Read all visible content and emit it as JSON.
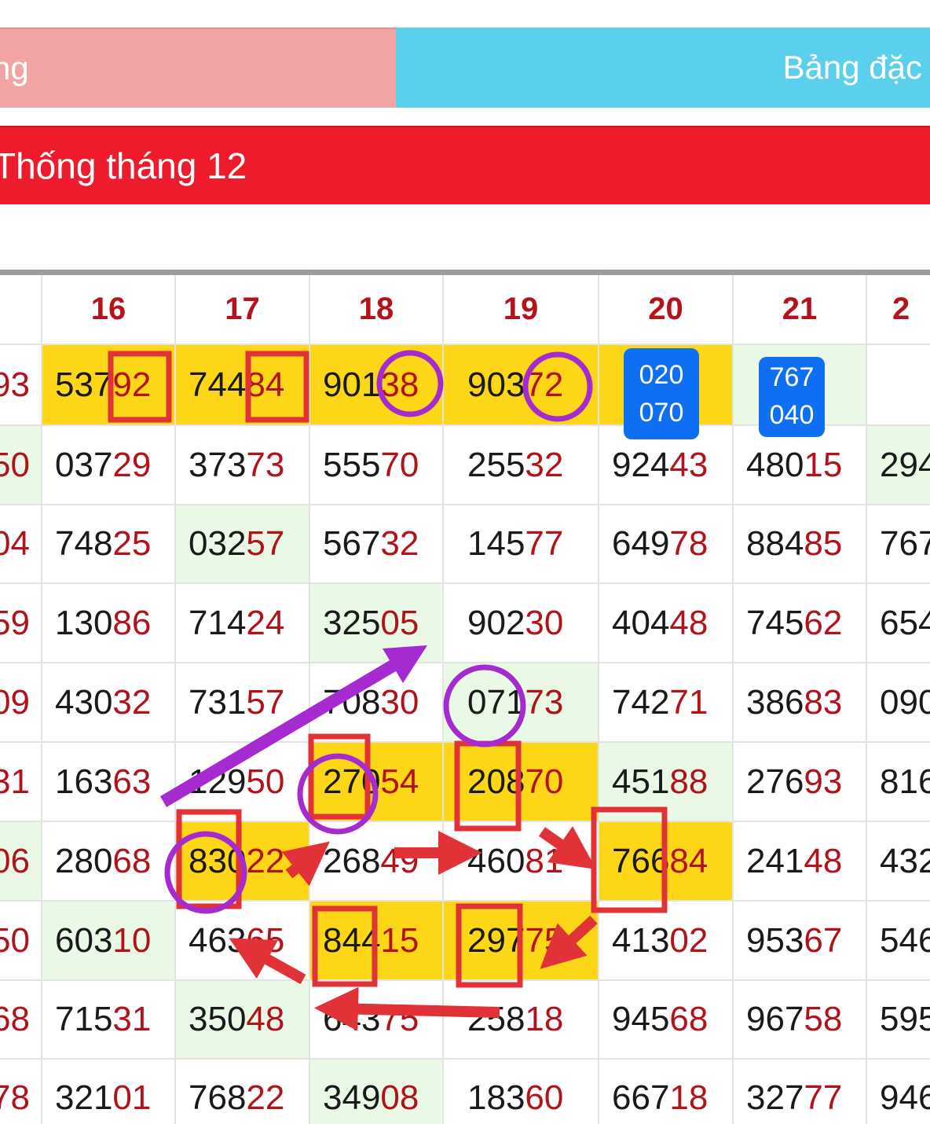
{
  "tabs": {
    "left_label": "ng",
    "right_label": "Bảng đặc"
  },
  "banner": {
    "title": "Thống tháng 12"
  },
  "table": {
    "headers": [
      "",
      "16",
      "17",
      "18",
      "19",
      "20",
      "21",
      "2"
    ],
    "rows": [
      [
        {
          "head": "",
          "tail": "93"
        },
        {
          "head": "537",
          "tail": "92",
          "hl": "yellow"
        },
        {
          "head": "744",
          "tail": "84",
          "hl": "yellow"
        },
        {
          "head": "901",
          "tail": "38",
          "hl": "yellow"
        },
        {
          "head": "903",
          "tail": "72",
          "hl": "yellow"
        },
        {
          "head": "",
          "tail": "",
          "hl": "yellow"
        },
        {
          "head": "",
          "tail": "",
          "hl": "green"
        },
        {
          "head": "",
          "tail": ""
        }
      ],
      [
        {
          "head": "",
          "tail": "50",
          "hl": "green"
        },
        {
          "head": "037",
          "tail": "29"
        },
        {
          "head": "373",
          "tail": "73"
        },
        {
          "head": "555",
          "tail": "70"
        },
        {
          "head": "255",
          "tail": "32"
        },
        {
          "head": "924",
          "tail": "43"
        },
        {
          "head": "480",
          "tail": "15"
        },
        {
          "head": "294",
          "tail": "",
          "hl": "green"
        }
      ],
      [
        {
          "head": "",
          "tail": "04"
        },
        {
          "head": "748",
          "tail": "25"
        },
        {
          "head": "032",
          "tail": "57",
          "hl": "green"
        },
        {
          "head": "567",
          "tail": "32"
        },
        {
          "head": "145",
          "tail": "77"
        },
        {
          "head": "649",
          "tail": "78"
        },
        {
          "head": "884",
          "tail": "85"
        },
        {
          "head": "767",
          "tail": ""
        }
      ],
      [
        {
          "head": "",
          "tail": "59"
        },
        {
          "head": "130",
          "tail": "86"
        },
        {
          "head": "714",
          "tail": "24"
        },
        {
          "head": "325",
          "tail": "05",
          "hl": "green"
        },
        {
          "head": "902",
          "tail": "30"
        },
        {
          "head": "404",
          "tail": "48"
        },
        {
          "head": "745",
          "tail": "62"
        },
        {
          "head": "654",
          "tail": ""
        }
      ],
      [
        {
          "head": "",
          "tail": "09"
        },
        {
          "head": "430",
          "tail": "32"
        },
        {
          "head": "731",
          "tail": "57"
        },
        {
          "head": "708",
          "tail": "30"
        },
        {
          "head": "071",
          "tail": "73",
          "hl": "green"
        },
        {
          "head": "742",
          "tail": "71"
        },
        {
          "head": "386",
          "tail": "83"
        },
        {
          "head": "090",
          "tail": ""
        }
      ],
      [
        {
          "head": "",
          "tail": "31"
        },
        {
          "head": "163",
          "tail": "63"
        },
        {
          "head": "129",
          "tail": "50"
        },
        {
          "head": "270",
          "tail": "54",
          "hl": "yellow"
        },
        {
          "head": "208",
          "tail": "70",
          "hl": "yellow"
        },
        {
          "head": "451",
          "tail": "88",
          "hl": "green"
        },
        {
          "head": "276",
          "tail": "93"
        },
        {
          "head": "816",
          "tail": ""
        }
      ],
      [
        {
          "head": "",
          "tail": "06",
          "hl": "green"
        },
        {
          "head": "280",
          "tail": "68"
        },
        {
          "head": "830",
          "tail": "22",
          "hl": "yellow"
        },
        {
          "head": "268",
          "tail": "49"
        },
        {
          "head": "460",
          "tail": "81"
        },
        {
          "head": "766",
          "tail": "84",
          "hl": "yellow"
        },
        {
          "head": "241",
          "tail": "48"
        },
        {
          "head": "432",
          "tail": ""
        }
      ],
      [
        {
          "head": "",
          "tail": "50"
        },
        {
          "head": "603",
          "tail": "10",
          "hl": "green"
        },
        {
          "head": "463",
          "tail": "65"
        },
        {
          "head": "844",
          "tail": "15",
          "hl": "yellow"
        },
        {
          "head": "297",
          "tail": "75",
          "hl": "yellow"
        },
        {
          "head": "413",
          "tail": "02"
        },
        {
          "head": "953",
          "tail": "67"
        },
        {
          "head": "546",
          "tail": ""
        }
      ],
      [
        {
          "head": "",
          "tail": "68"
        },
        {
          "head": "715",
          "tail": "31"
        },
        {
          "head": "350",
          "tail": "48",
          "hl": "green"
        },
        {
          "head": "643",
          "tail": "75"
        },
        {
          "head": "258",
          "tail": "18"
        },
        {
          "head": "945",
          "tail": "68"
        },
        {
          "head": "967",
          "tail": "58"
        },
        {
          "head": "595",
          "tail": ""
        }
      ],
      [
        {
          "head": "",
          "tail": "78"
        },
        {
          "head": "321",
          "tail": "01"
        },
        {
          "head": "768",
          "tail": "22"
        },
        {
          "head": "349",
          "tail": "08",
          "hl": "green"
        },
        {
          "head": "183",
          "tail": "60"
        },
        {
          "head": "667",
          "tail": "18"
        },
        {
          "head": "327",
          "tail": "77"
        },
        {
          "head": "946",
          "tail": ""
        }
      ]
    ],
    "badges": [
      {
        "line1": "020",
        "line2": "070"
      },
      {
        "line1": "767",
        "line2": "040"
      }
    ]
  },
  "colors": {
    "accent_red": "#ee1b2c",
    "tab_pink": "#f2a3a4",
    "tab_cyan": "#5bd0ec",
    "highlight_yellow": "#fdd617",
    "badge_blue": "#0f6ff2",
    "mark_red": "#e03237",
    "mark_purple": "#a52bd0"
  }
}
